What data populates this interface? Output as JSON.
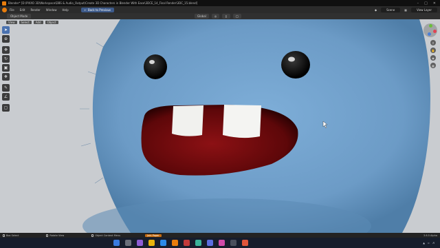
{
  "window": {
    "title": "Blender* [D:\\PIXXO 3D\\Workspace\\DBS & Audio_Output\\Create 3D Characters in Blender With Ease\\3DCE_14_Final Render\\3DC_15.blend]"
  },
  "menubar": {
    "items": [
      "File",
      "Edit",
      "Render",
      "Window",
      "Help"
    ],
    "back_button": "Back to Previous",
    "scene_label": "Scene",
    "view_layer_label": "View Layer"
  },
  "header": {
    "mode": "Object Mode",
    "menus": [
      "View",
      "Select",
      "Add",
      "Object"
    ],
    "transform": "Global"
  },
  "statusbar": {
    "items": [
      "Box Select",
      "Rotate View",
      "Object Context Menu"
    ],
    "badge": "Join Paper",
    "version": "3.6.5 Alpha"
  },
  "colors": {
    "fur": "#6f9fc9",
    "viewport_bg": "#c9ccd0",
    "accent": "#e87d0d",
    "mouth": "#7b0d10"
  },
  "icons": {
    "toolbar": [
      "cursor-icon",
      "select-icon",
      "move-icon",
      "rotate-icon",
      "scale-icon",
      "transform-icon",
      "annotate-icon",
      "measure-icon",
      "add-cube-icon"
    ]
  }
}
